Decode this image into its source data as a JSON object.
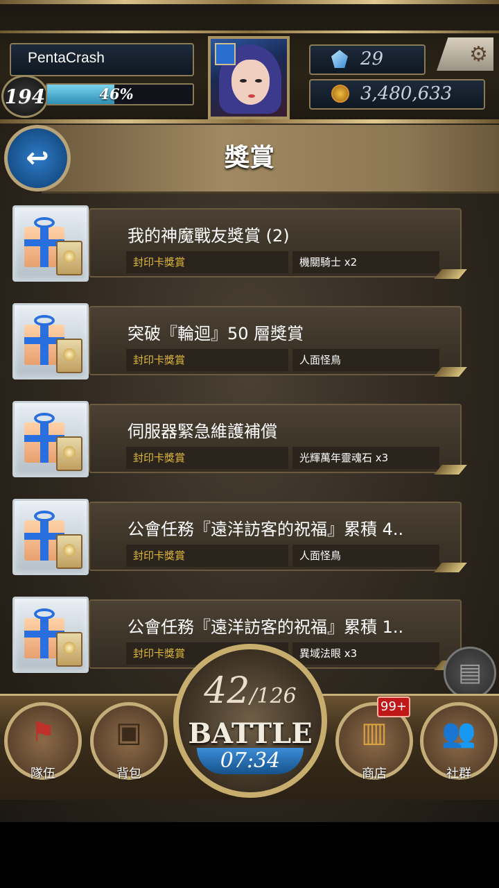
{
  "header": {
    "player_name": "PentaCrash",
    "level": "194",
    "exp_percent_text": "46%",
    "exp_fraction": 0.46,
    "gems": "29",
    "coins": "3,480,633"
  },
  "page": {
    "title": "獎賞"
  },
  "rewards": [
    {
      "title": "我的神魔戰友獎賞 (2)",
      "type": "封印卡獎賞",
      "item": "機關騎士 x2"
    },
    {
      "title": "突破『輪迴』50 層獎賞",
      "type": "封印卡獎賞",
      "item": "人面怪鳥"
    },
    {
      "title": "伺服器緊急維護補償",
      "type": "封印卡獎賞",
      "item": "光輝萬年靈魂石 x3"
    },
    {
      "title": "公會任務『遠洋訪客的祝福』累積 4..",
      "type": "封印卡獎賞",
      "item": "人面怪鳥"
    },
    {
      "title": "公會任務『遠洋訪客的祝福』累積 1..",
      "type": "封印卡獎賞",
      "item": "異域法眼 x3"
    }
  ],
  "battle": {
    "current": "42",
    "max": "/126",
    "label": "BATTLE",
    "timer": "07:34"
  },
  "nav": {
    "team": "隊伍",
    "bag": "背包",
    "shop": "商店",
    "shop_badge": "99+",
    "social": "社群"
  },
  "icons": [
    "gem-icon",
    "coin-icon",
    "gear-icon",
    "back-arrow-icon",
    "gift-icon",
    "flag-icon",
    "bag-icon",
    "chest-icon",
    "people-icon"
  ]
}
